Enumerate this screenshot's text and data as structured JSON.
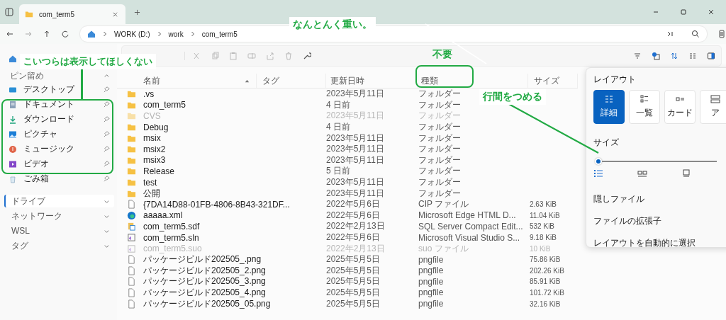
{
  "window": {
    "tab_title": "com_term5"
  },
  "address": {
    "segments": [
      "WORK (D:)",
      "work",
      "com_term5"
    ]
  },
  "sidebar": {
    "pinned_header": "ピン留め",
    "items": [
      {
        "label": "デスクトップ",
        "kind": "desktop"
      },
      {
        "label": "ドキュメント",
        "kind": "document"
      },
      {
        "label": "ダウンロード",
        "kind": "download"
      },
      {
        "label": "ピクチャ",
        "kind": "picture"
      },
      {
        "label": "ミュージック",
        "kind": "music"
      },
      {
        "label": "ビデオ",
        "kind": "video"
      },
      {
        "label": "ごみ箱",
        "kind": "trash"
      }
    ],
    "sections": [
      {
        "label": "ドライブ",
        "selected": true
      },
      {
        "label": "ネットワーク",
        "selected": false
      },
      {
        "label": "WSL",
        "selected": false
      },
      {
        "label": "タグ",
        "selected": false
      }
    ]
  },
  "table": {
    "columns": [
      "名前",
      "タグ",
      "更新日時",
      "種類",
      "サイズ"
    ],
    "rows": [
      {
        "kind": "folder",
        "hidden": false,
        "name": ".vs",
        "date": "2023年5月11日",
        "type": "フォルダー"
      },
      {
        "kind": "folder",
        "hidden": false,
        "name": "com_term5",
        "date": "4 日前",
        "type": "フォルダー"
      },
      {
        "kind": "folder",
        "hidden": true,
        "name": "CVS",
        "date": "2023年5月11日",
        "type": "フォルダー"
      },
      {
        "kind": "folder",
        "hidden": false,
        "name": "Debug",
        "date": "4 日前",
        "type": "フォルダー"
      },
      {
        "kind": "folder",
        "hidden": false,
        "name": "msix",
        "date": "2023年5月11日",
        "type": "フォルダー"
      },
      {
        "kind": "folder",
        "hidden": false,
        "name": "msix2",
        "date": "2023年5月11日",
        "type": "フォルダー"
      },
      {
        "kind": "folder",
        "hidden": false,
        "name": "msix3",
        "date": "2023年5月11日",
        "type": "フォルダー"
      },
      {
        "kind": "folder",
        "hidden": false,
        "name": "Release",
        "date": "5 日前",
        "type": "フォルダー"
      },
      {
        "kind": "folder",
        "hidden": false,
        "name": "test",
        "date": "2023年5月11日",
        "type": "フォルダー"
      },
      {
        "kind": "folder",
        "hidden": false,
        "name": "公開",
        "date": "2023年5月11日",
        "type": "フォルダー"
      },
      {
        "kind": "file",
        "hidden": false,
        "name": "{7DA14D88-01FB-4806-8B43-321DF...",
        "date": "2022年5月6日",
        "type": "CIP ファイル",
        "size": "2.63 KiB"
      },
      {
        "kind": "edge",
        "hidden": false,
        "name": "aaaaa.xml",
        "date": "2022年5月6日",
        "type": "Microsoft Edge HTML D...",
        "size": "11.04 KiB"
      },
      {
        "kind": "database",
        "hidden": false,
        "name": "com_term5.sdf",
        "date": "2022年2月13日",
        "type": "SQL Server Compact Edit...",
        "size": "532 KiB"
      },
      {
        "kind": "solution",
        "hidden": false,
        "name": "com_term5.sln",
        "date": "2022年5月6日",
        "type": "Microsoft Visual Studio S...",
        "size": "9.18 KiB"
      },
      {
        "kind": "solution",
        "hidden": true,
        "name": "com_term5.suo",
        "date": "2022年2月13日",
        "type": "suo ファイル",
        "size": "10 KiB"
      },
      {
        "kind": "file",
        "hidden": false,
        "name": "パッケージビルド202505_.png",
        "date": "2025年5月5日",
        "type": "pngfile",
        "size": "75.86 KiB"
      },
      {
        "kind": "file",
        "hidden": false,
        "name": "パッケージビルド202505_2.png",
        "date": "2025年5月5日",
        "type": "pngfile",
        "size": "202.26 KiB"
      },
      {
        "kind": "file",
        "hidden": false,
        "name": "パッケージビルド202505_3.png",
        "date": "2025年5月5日",
        "type": "pngfile",
        "size": "85.91 KiB"
      },
      {
        "kind": "file",
        "hidden": false,
        "name": "パッケージビルド202505_4.png",
        "date": "2025年5月5日",
        "type": "pngfile",
        "size": "101.72 KiB"
      },
      {
        "kind": "file",
        "hidden": false,
        "name": "パッケージビルド202505_05.png",
        "date": "2025年5月5日",
        "type": "pngfile",
        "size": "32.16 KiB"
      }
    ]
  },
  "layout_panel": {
    "title": "レイアウト",
    "options": [
      {
        "label": "詳細",
        "kind": "details",
        "selected": true
      },
      {
        "label": "一覧",
        "kind": "list",
        "selected": false
      },
      {
        "label": "カード",
        "kind": "card",
        "selected": false
      },
      {
        "label": "ア",
        "kind": "icon",
        "selected": false
      }
    ],
    "size_label": "サイズ",
    "size": {
      "level": 0
    },
    "menu": [
      "隠しファイル",
      "ファイルの拡張子",
      "レイアウトを自動的に選択"
    ]
  },
  "annotations": [
    {
      "kind": "top",
      "text": "なんとんく重い。"
    },
    {
      "kind": "sidebar",
      "text": "こいつらは表示してほしくない"
    },
    {
      "kind": "column",
      "text": "不要"
    },
    {
      "kind": "spacing",
      "text": "行間をつめる"
    }
  ]
}
